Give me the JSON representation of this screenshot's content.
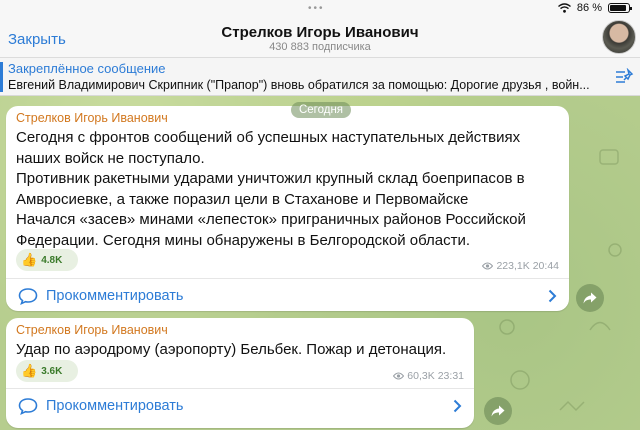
{
  "status": {
    "battery": "86 %"
  },
  "header": {
    "close_label": "Закрыть",
    "title": "Стрелков Игорь Иванович",
    "subscribers": "430 883 подписчика"
  },
  "pinned": {
    "title": "Закреплённое сообщение",
    "text": "Евгений Владимирович Скрипник (\"Прапор\") вновь обратился за помощью:   Дорогие друзья , войн..."
  },
  "date_label": "Сегодня",
  "messages": [
    {
      "author": "Стрелков Игорь Иванович",
      "lines": [
        "Сегодня с фронтов сообщений об успешных наступательных действиях",
        "наших войск не поступало.",
        "Противник ракетными ударами  уничтожил крупный склад боеприпасов в",
        "Амвросиевке, а также поразил цели в Стаханове и Первомайске",
        "Начался «засев» минами «лепесток» приграничных районов Российской",
        "Федерации. Сегодня мины обнаружены в Белгородской области."
      ],
      "reaction_emoji": "👍",
      "reaction_count": "4.8K",
      "views": "223,1K",
      "time": "20:44",
      "comment_label": "Прокомментировать"
    },
    {
      "author": "Стрелков Игорь Иванович",
      "lines": [
        "Удар по аэродрому (аэропорту) Бельбек. Пожар и детонация."
      ],
      "reaction_emoji": "👍",
      "reaction_count": "3.6K",
      "views": "60,3K",
      "time": "23:31",
      "comment_label": "Прокомментировать"
    }
  ],
  "icons": {
    "close": "close-link",
    "wifi": "wifi-icon",
    "battery": "battery-icon",
    "pin": "pin-list-icon",
    "views": "eye-icon",
    "comment": "comment-bubble-icon",
    "chevron": "chevron-right-icon",
    "share": "share-arrow-icon"
  },
  "colors": {
    "accent": "#2d7cd6",
    "author": "#d2781f",
    "wallpaper": "#b6cd8e"
  }
}
